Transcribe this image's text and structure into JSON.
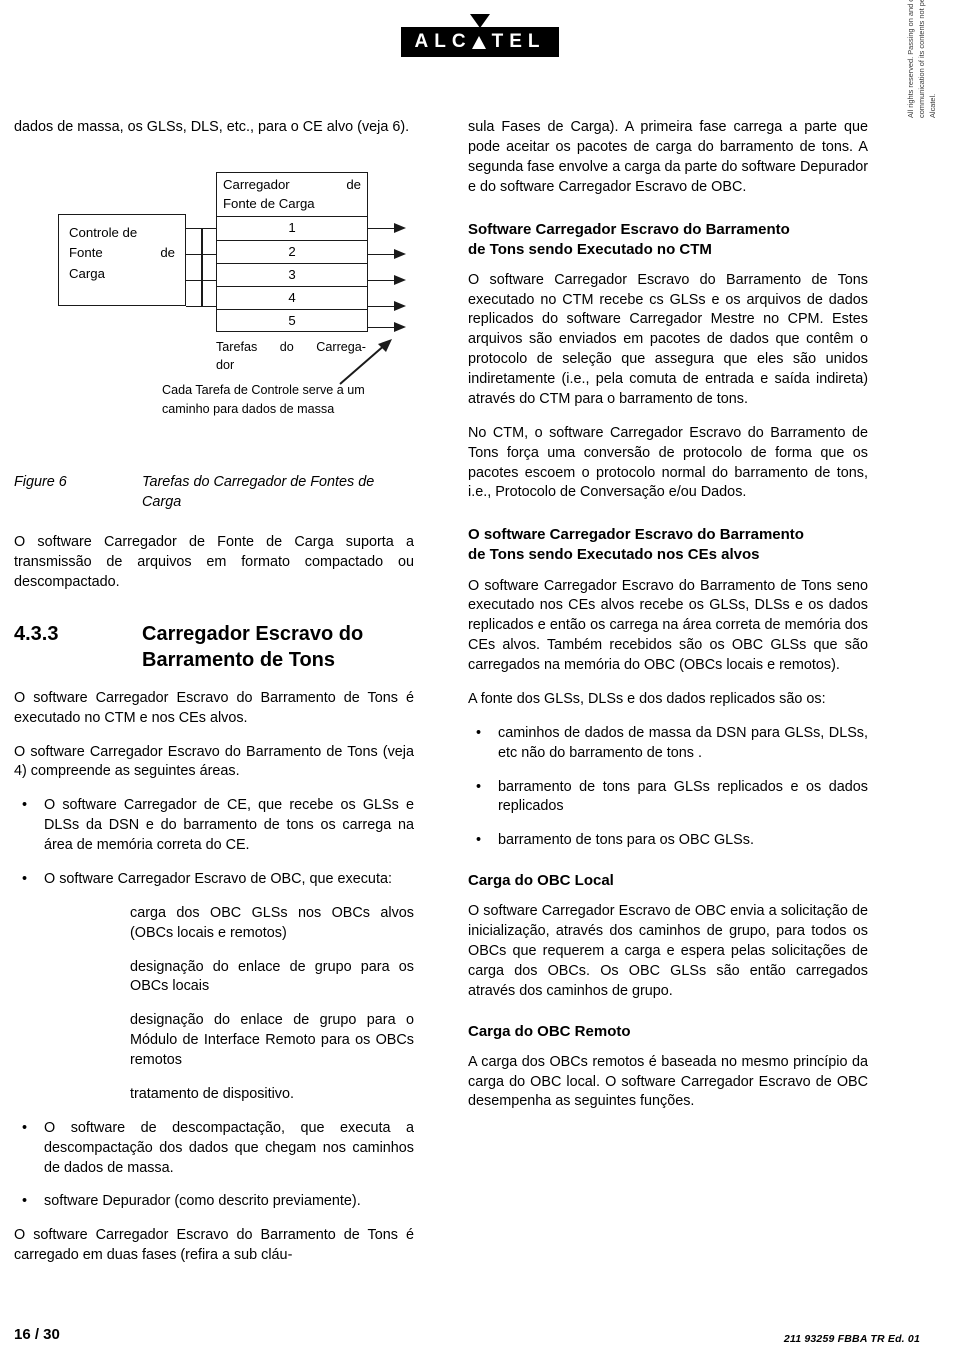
{
  "logo": {
    "letters": [
      "A",
      "L",
      "C",
      "T",
      "E",
      "L"
    ],
    "name": "ALCATEL"
  },
  "left_column": {
    "intro_paragraph": "dados de massa, os GLSs, DLS, etc., para o CE alvo (veja 6).",
    "figure": {
      "control_box": {
        "line1": "Controle de",
        "line2_a": "Fonte",
        "line2_b": "de",
        "line3": "Carga"
      },
      "loader_box": {
        "title_a": "Carregador",
        "title_b": "de",
        "title_line2": "Fonte de Carga",
        "rows": [
          "1",
          "2",
          "3",
          "4",
          "5"
        ]
      },
      "tasks_label_a": "Tarefas",
      "tasks_label_b": "do",
      "tasks_label_c": "Carrega-",
      "tasks_label_d": "dor",
      "note": "Cada Tarefa de Controle serve a um caminho para dados de massa",
      "caption_label": "Figure 6",
      "caption_text": "Tarefas do Carregador de Fontes de Carga"
    },
    "paragraph_after_figure": "O software Carregador de Fonte de Carga  suporta a transmissão de arquivos em  formato compactado ou descompactado.",
    "section": {
      "number": "4.3.3",
      "title_line1": "Carregador Escravo do",
      "title_line2": "Barramento de Tons"
    },
    "paragraph_1": "O software Carregador Escravo do Barramento de Tons é executado no CTM e nos CEs alvos.",
    "paragraph_2": "O software Carregador Escravo do Barramento de Tons (veja 4) compreende as seguintes áreas.",
    "bullets": [
      "O software Carregador de CE, que recebe os GLSs e DLSs da DSN e do barramento de tons os carrega na área de memória correta do CE.",
      "O software Carregador Escravo de OBC, que executa:"
    ],
    "sub_items": [
      "carga dos OBC GLSs nos OBCs alvos (OBCs locais e remotos)",
      "designação do enlace de grupo para os OBCs locais",
      "designação do enlace de grupo para o Módulo de Interface Remoto para os OBCs remotos",
      "tratamento de dispositivo."
    ],
    "bullets_2": [
      "O software de descompactação, que executa a descompactação dos dados que chegam nos caminhos de dados de massa.",
      "software Depurador (como descrito previamente)."
    ],
    "paragraph_3": "O software Carregador Escravo do Barramento de Tons é carregado em duas fases (refira a sub cláu-"
  },
  "right_column": {
    "paragraph_1": "sula Fases de Carga). A primeira fase carrega a parte que pode aceitar os pacotes de carga do barramento de tons. A segunda fase envolve a carga da parte do software Depurador e do software Carregador Escravo de OBC.",
    "heading_1_line1": "Software Carregador Escravo do Barramento",
    "heading_1_line2": "de Tons sendo Executado no CTM",
    "paragraph_2": "O software Carregador Escravo do Barramento de Tons executado no CTM recebe cs GLSs e os arquivos de dados replicados do software Carregador Mestre no CPM. Estes arquivos são enviados em pacotes de dados que contêm o protocolo de seleção que assegura que eles são unidos indiretamente (i.e., pela comuta de entrada e saída indireta) através do CTM para o barramento de tons.",
    "paragraph_3": "No CTM, o software Carregador Escravo do Barramento de Tons força uma conversão de protocolo de forma que os pacotes escoem o protocolo normal do barramento de tons, i.e., Protocolo de Conversação e/ou Dados.",
    "heading_2_line1": "O software Carregador Escravo do Barramento",
    "heading_2_line2": "de Tons sendo Executado nos CEs alvos",
    "paragraph_4": "O software Carregador Escravo do Barramento de Tons seno executado nos CEs alvos recebe os GLSs, DLSs e os dados replicados e então os carrega na área correta de memória dos CEs alvos. Também recebidos são os OBC GLSs que são carregados na memória do OBC (OBCs locais e remotos).",
    "paragraph_5": "A fonte dos GLSs, DLSs e dos dados replicados são os:",
    "bullets": [
      "caminhos de dados de massa da DSN para GLSs, DLSs, etc não do barramento de tons .",
      "barramento de tons para GLSs replicados e os dados replicados",
      "barramento de tons para os OBC GLSs."
    ],
    "heading_3": "Carga do OBC Local",
    "paragraph_6": "O software Carregador Escravo de OBC envia a solicitação de inicialização, através dos caminhos de grupo, para todos os OBCs que requerem a carga e espera pelas solicitações de carga dos OBCs. Os OBC GLSs são então carregados através dos caminhos de grupo.",
    "heading_4": "Carga do OBC Remoto",
    "paragraph_7": "A carga dos OBCs remotos é baseada no mesmo princípio da carga do OBC local. O software Carregador Escravo de OBC desempenha as seguintes funções."
  },
  "copyright": "All rights reserved. Passing on and copying of this document, use and communication of its contents not permitted without written authorization from Alcatel.",
  "footer": {
    "page": "16 / 30",
    "doc_ref": "211 93259 FBBA TR   Ed. 01"
  }
}
